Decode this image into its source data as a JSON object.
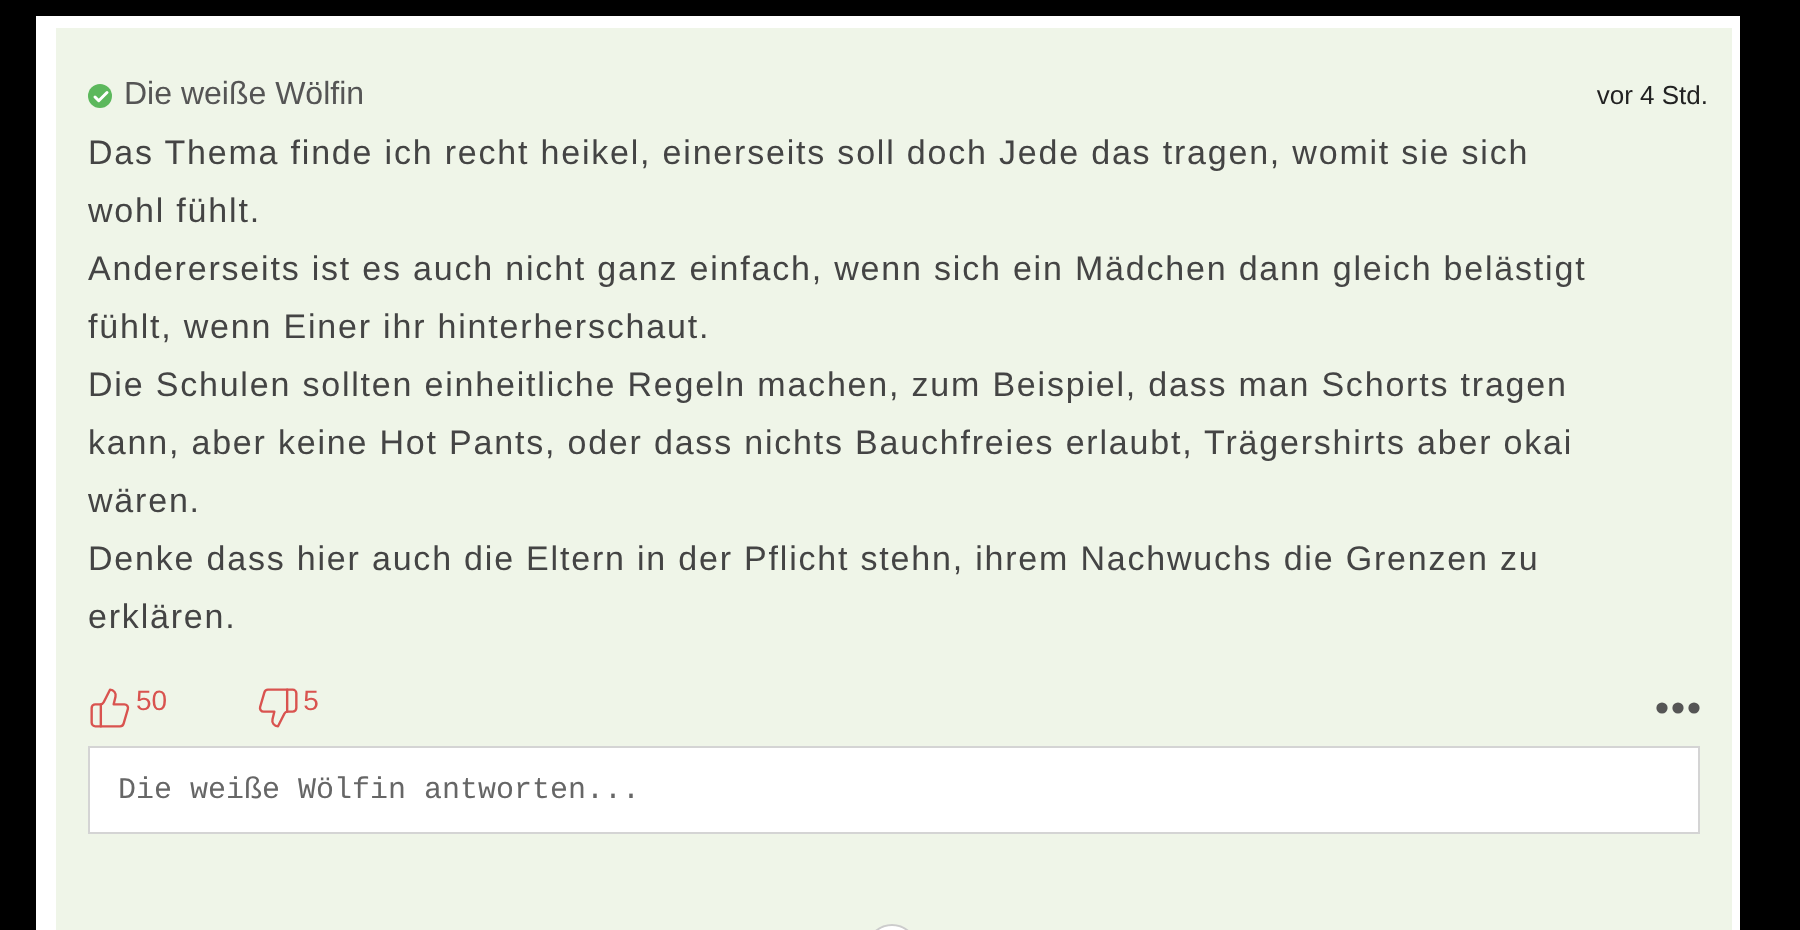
{
  "comment": {
    "author": "Die weiße Wölfin",
    "verified": true,
    "time": "vor 4 Std.",
    "paragraphs": [
      "Das Thema finde ich recht heikel, einerseits soll doch Jede das tragen, womit sie sich wohl fühlt.",
      "Andererseits ist es auch nicht ganz einfach, wenn sich ein Mädchen dann gleich belästigt fühlt, wenn Einer ihr hinterherschaut.",
      "Die Schulen sollten einheitliche Regeln machen, zum Beispiel, dass man Schorts tragen kann, aber keine Hot Pants, oder dass nichts Bauchfreies erlaubt, Trägershirts aber okai wären.",
      "Denke dass hier auch die Eltern in der Pflicht stehn, ihrem Nachwuchs die Grenzen zu erklären."
    ],
    "likes": "50",
    "dislikes": "5"
  },
  "reply": {
    "placeholder": "Die weiße Wölfin antworten..."
  }
}
